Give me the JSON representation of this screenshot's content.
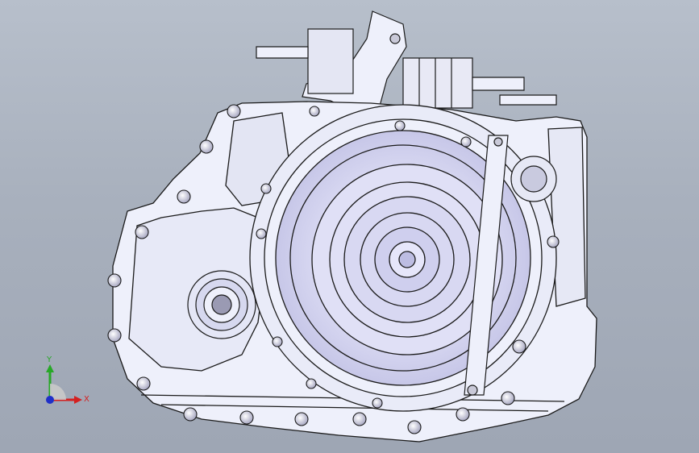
{
  "triad": {
    "x_label": "X",
    "y_label": "Y",
    "x_color": "#d42020",
    "y_color": "#27a827",
    "z_color": "#1f2fc8"
  },
  "model": {
    "fill_color": "#eef0fb",
    "line_color": "#1a1a1a"
  }
}
